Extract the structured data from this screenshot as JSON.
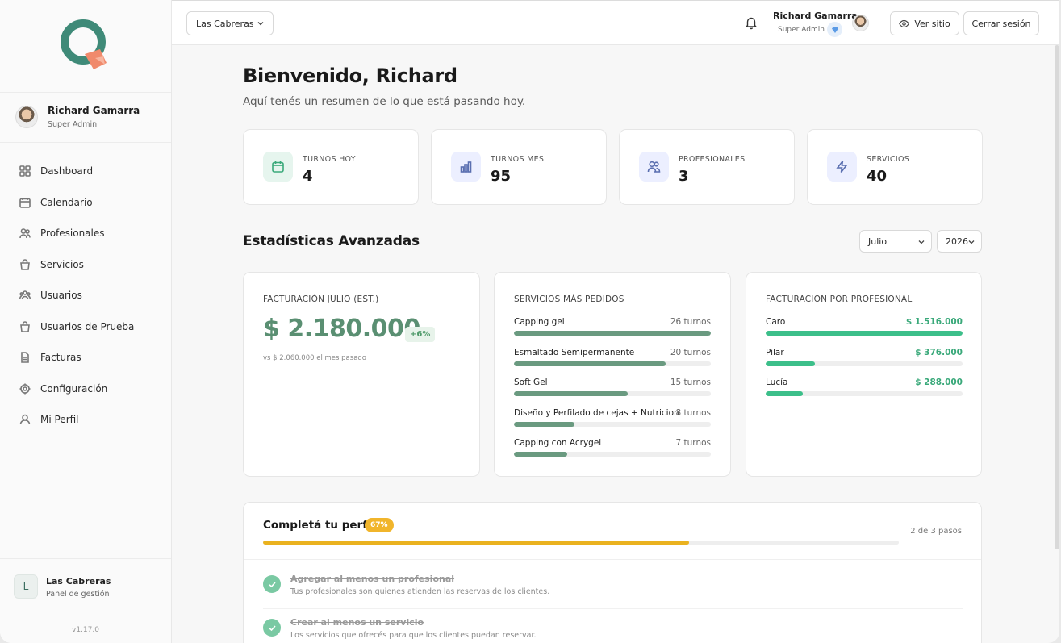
{
  "brand": {
    "logo_icon": "q-logo-icon"
  },
  "sidebar": {
    "user": {
      "name": "Richard Gamarra",
      "role": "Super Admin"
    },
    "items": [
      {
        "label": "Dashboard",
        "icon": "grid-icon"
      },
      {
        "label": "Calendario",
        "icon": "calendar-icon"
      },
      {
        "label": "Profesionales",
        "icon": "users-icon"
      },
      {
        "label": "Servicios",
        "icon": "bag-icon"
      },
      {
        "label": "Usuarios",
        "icon": "group-icon"
      },
      {
        "label": "Usuarios de Prueba",
        "icon": "bag-icon"
      },
      {
        "label": "Facturas",
        "icon": "file-icon"
      },
      {
        "label": "Configuración",
        "icon": "gear-icon"
      },
      {
        "label": "Mi Perfil",
        "icon": "user-icon"
      }
    ],
    "business": {
      "initial": "L",
      "name": "Las Cabreras",
      "subtitle": "Panel de gestión",
      "version": "v1.17.0"
    }
  },
  "topbar": {
    "location": "Las Cabreras",
    "user_name": "Richard Gamarra",
    "user_role": "Super Admin",
    "view_site": "Ver sitio",
    "logout": "Cerrar sesión"
  },
  "main": {
    "welcome": "Bienvenido, Richard",
    "subtitle": "Aquí tenés un resumen de lo que está pasando hoy.",
    "stats": [
      {
        "label": "TURNOS HOY",
        "value": "4",
        "icon": "calendar-icon",
        "color": "#3aa97a",
        "bg": "#e6f5ee"
      },
      {
        "label": "TURNOS MES",
        "value": "95",
        "icon": "bar-chart-icon",
        "color": "#5a6fb0",
        "bg": "#ecefff"
      },
      {
        "label": "PROFESIONALES",
        "value": "3",
        "icon": "users-icon",
        "color": "#5a6fb0",
        "bg": "#ecefff"
      },
      {
        "label": "SERVICIOS",
        "value": "40",
        "icon": "bolt-icon",
        "color": "#5a6fb0",
        "bg": "#ecefff"
      }
    ],
    "advanced_title": "Estadísticas Avanzadas",
    "month": "Julio",
    "year": "2026",
    "billing": {
      "heading": "FACTURACIÓN JULIO (EST.)",
      "amount": "$ 2.180.000",
      "change": "+6%",
      "previous": "vs $ 2.060.000 el mes pasado"
    },
    "services": {
      "heading": "SERVICIOS MÁS PEDIDOS",
      "items": [
        {
          "name": "Capping gel",
          "value_label": "26 turnos",
          "value": 26
        },
        {
          "name": "Esmaltado Semipermanente",
          "value_label": "20 turnos",
          "value": 20
        },
        {
          "name": "Soft Gel",
          "value_label": "15 turnos",
          "value": 15
        },
        {
          "name": "Diseño y Perfilado de cejas + Nutricion",
          "value_label": "8 turnos",
          "value": 8
        },
        {
          "name": "Capping con Acrygel",
          "value_label": "7 turnos",
          "value": 7
        }
      ]
    },
    "by_professional": {
      "heading": "FACTURACIÓN POR PROFESIONAL",
      "items": [
        {
          "name": "Caro",
          "value_label": "$ 1.516.000",
          "value": 1516000
        },
        {
          "name": "Pilar",
          "value_label": "$ 376.000",
          "value": 376000
        },
        {
          "name": "Lucía",
          "value_label": "$ 288.000",
          "value": 288000
        }
      ]
    },
    "profile": {
      "title": "Completá tu perfil",
      "percent_label": "67%",
      "progress": 0.67,
      "steps": "2 de 3 pasos",
      "tasks": [
        {
          "title": "Agregar al menos un profesional",
          "desc": "Tus profesionales son quienes atienden las reservas de los clientes."
        },
        {
          "title": "Crear al menos un servicio",
          "desc": "Los servicios que ofrecés para que los clientes puedan reservar."
        }
      ]
    }
  },
  "colors": {
    "accent_green": "#5a8f72",
    "bar_green": "#3cbf8a",
    "progress_yellow": "#eab21f"
  }
}
